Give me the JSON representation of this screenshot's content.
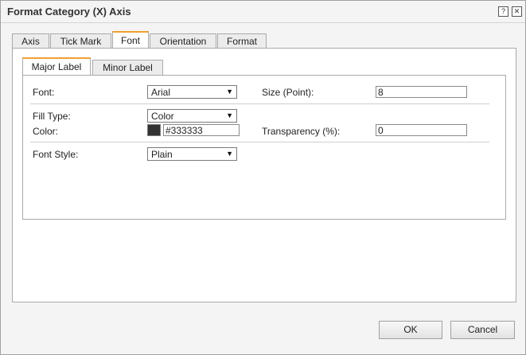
{
  "window": {
    "title": "Format Category (X) Axis",
    "help_label": "?",
    "close_label": "✕"
  },
  "tabs": [
    {
      "label": "Axis"
    },
    {
      "label": "Tick Mark"
    },
    {
      "label": "Font",
      "active": true
    },
    {
      "label": "Orientation"
    },
    {
      "label": "Format"
    }
  ],
  "subtabs": [
    {
      "label": "Major Label",
      "active": true
    },
    {
      "label": "Minor Label"
    }
  ],
  "form": {
    "font_label": "Font:",
    "font_value": "Arial",
    "size_label": "Size (Point):",
    "size_value": "8",
    "fill_type_label": "Fill Type:",
    "fill_type_value": "Color",
    "color_label": "Color:",
    "color_value": "#333333",
    "color_swatch": "#333333",
    "transparency_label": "Transparency (%):",
    "transparency_value": "0",
    "font_style_label": "Font Style:",
    "font_style_value": "Plain",
    "dropdown_arrow": "▼"
  },
  "buttons": {
    "ok": "OK",
    "cancel": "Cancel"
  },
  "colors": {
    "active_tab_accent": "#f0a030"
  }
}
